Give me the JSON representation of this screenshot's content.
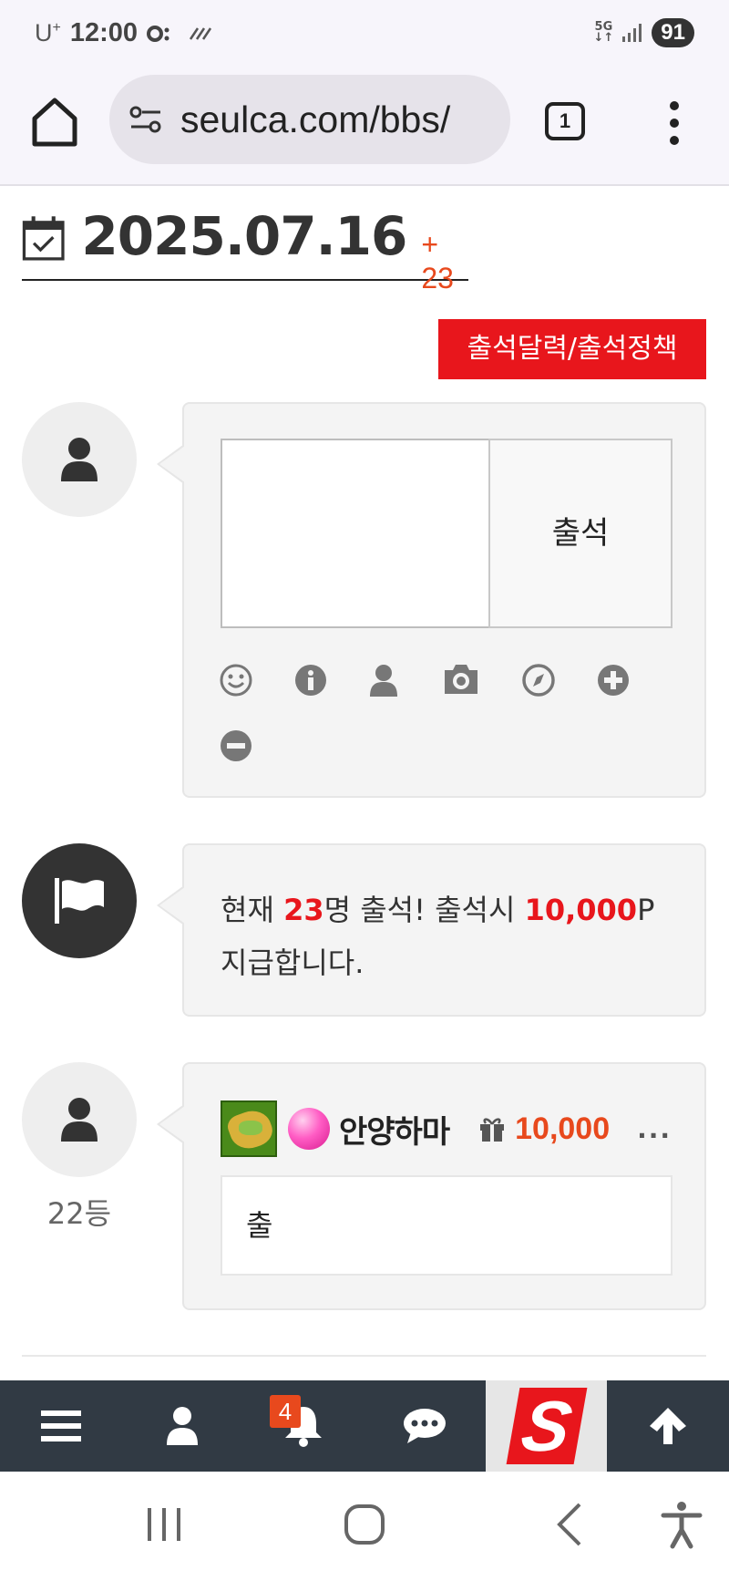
{
  "status_bar": {
    "carrier": "U",
    "carrier_sup": "+",
    "time": "12:00",
    "network": "5G",
    "battery": "91"
  },
  "browser": {
    "url": "seulca.com/bbs/",
    "tab_count": "1"
  },
  "attendance": {
    "date": "2025.07.16",
    "count_delta": "+ 23",
    "calendar_button": "출석달력/출석정책",
    "submit_label": "출석",
    "comment_value": ""
  },
  "notice": {
    "prefix": "현재 ",
    "count": "23",
    "middle": "명 출석! 출석시 ",
    "points": "10,000",
    "suffix": "P",
    "line2": "지급합니다."
  },
  "entry": {
    "nickname": "안양하마",
    "points": "10,000",
    "more": "...",
    "message": "출",
    "rank": "22등"
  },
  "appbar": {
    "notification_count": "4",
    "logo_letter": "S"
  },
  "colors": {
    "accent_red": "#e8161c",
    "accent_orange": "#e8491d",
    "appbar_bg": "#313a44"
  }
}
